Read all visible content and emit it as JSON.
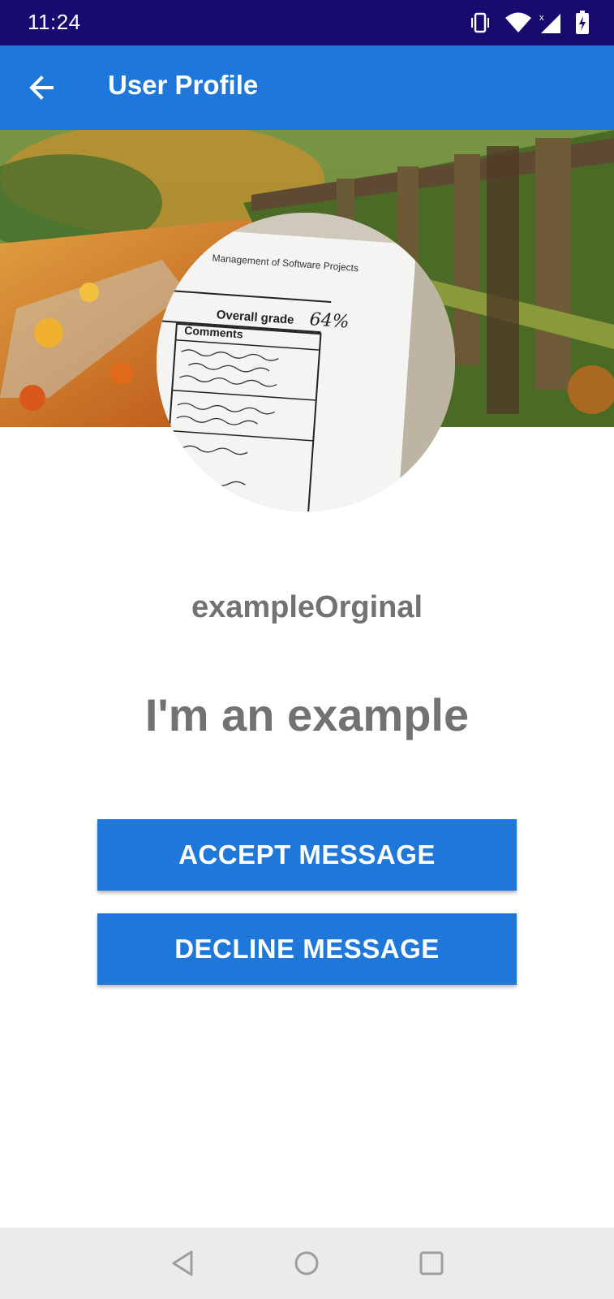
{
  "status_bar": {
    "time": "11:24",
    "icons": [
      "vibrate-icon",
      "wifi-icon",
      "signal-icon",
      "battery-charging-icon"
    ]
  },
  "app_bar": {
    "title": "User Profile",
    "back_icon": "arrow-back-icon"
  },
  "avatar_image": {
    "doc_title": "Management of Software Projects",
    "heading": "Overall grade",
    "grade": "64%",
    "column": "Comments"
  },
  "profile": {
    "username": "exampleOrginal",
    "status": "I'm an example"
  },
  "actions": {
    "accept_label": "ACCEPT MESSAGE",
    "decline_label": "DECLINE MESSAGE"
  },
  "nav_bar": {
    "icons": [
      "back-triangle-icon",
      "home-circle-icon",
      "recents-square-icon"
    ]
  },
  "colors": {
    "status_bar": "#170c6e",
    "accent": "#1f78d9",
    "text_gray": "#727272",
    "nav_bar": "#ebebeb"
  }
}
